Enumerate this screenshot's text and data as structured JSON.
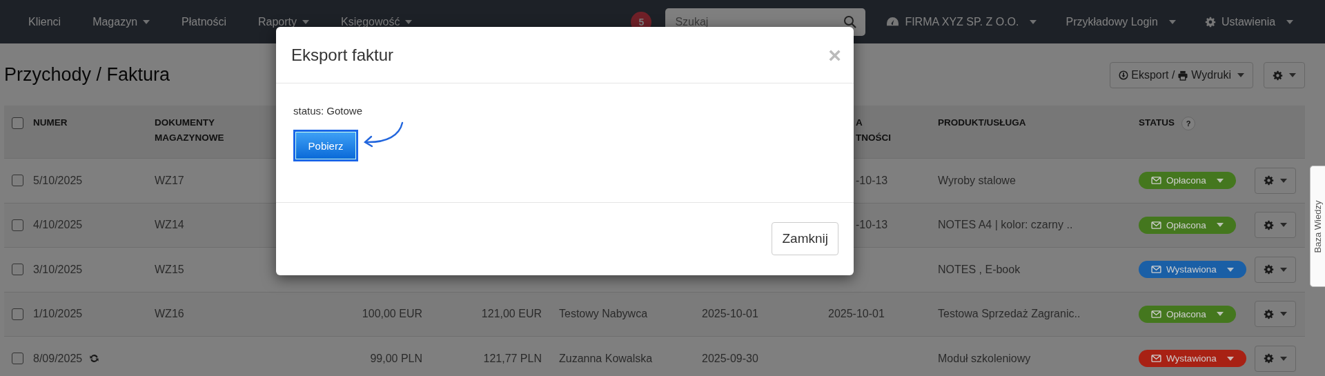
{
  "navbar": {
    "items": [
      {
        "label": "Klienci",
        "dropdown": false
      },
      {
        "label": "Magazyn",
        "dropdown": true
      },
      {
        "label": "Płatności",
        "dropdown": false
      },
      {
        "label": "Raporty",
        "dropdown": true
      },
      {
        "label": "Księgowość",
        "dropdown": true
      }
    ],
    "badge": "5",
    "search": {
      "placeholder": "Szukaj"
    },
    "right_items": [
      {
        "label": "FIRMA XYZ SP. Z O.O.",
        "dropdown": true
      },
      {
        "label": "Przykładowy Login",
        "dropdown": true
      },
      {
        "label": "Ustawienia",
        "dropdown": true
      }
    ]
  },
  "page": {
    "title": "Przychody / Faktura",
    "export_button": [
      "Eksport /",
      "Wydruki"
    ]
  },
  "table": {
    "header_checked": false,
    "columns": [
      {
        "lines": [
          "NUMER"
        ]
      },
      {
        "lines": [
          "DOKUMENTY",
          "MAGAZYNOWE"
        ]
      },
      {
        "lines": [
          "A",
          "TNOŚCI"
        ]
      },
      {
        "lines": [
          "PRODUKT/USŁUGA"
        ]
      },
      {
        "lines": [
          "STATUS"
        ],
        "help": "?"
      }
    ],
    "rows": [
      {
        "checked": false,
        "number": "5/10/2025",
        "recurring": false,
        "documents": "WZ17",
        "due_tail": "-10-13",
        "product": "Wyroby stalowe",
        "status": {
          "label": "Opłacona",
          "color": "#44771e"
        }
      },
      {
        "checked": false,
        "number": "4/10/2025",
        "recurring": false,
        "documents": "WZ14",
        "due_tail": "-10-13",
        "product": "NOTES A4 | kolor: czarny ..",
        "status": {
          "label": "Opłacona",
          "color": "#44771e"
        }
      },
      {
        "checked": false,
        "number": "3/10/2025",
        "recurring": false,
        "documents": "WZ15",
        "product": "NOTES , E-book",
        "status": {
          "label": "Wystawiona",
          "color": "#1a5fa6"
        }
      },
      {
        "checked": false,
        "number": "1/10/2025",
        "recurring": false,
        "documents": "WZ16",
        "net": "100,00 EUR",
        "gross": "121,00 EUR",
        "buyer": "Testowy Nabywca",
        "date": "2025-10-01",
        "due": "2025-10-01",
        "product": "Testowa Sprzedaż Zagranic..",
        "status": {
          "label": "Opłacona",
          "color": "#44771e"
        }
      },
      {
        "checked": false,
        "number": "8/09/2025",
        "recurring": true,
        "net": "99,00 PLN",
        "gross": "121,77 PLN",
        "buyer": "Zuzanna Kowalska",
        "date": "2025-09-30",
        "product": "Moduł szkoleniowy",
        "status": {
          "label": "Wystawiona",
          "color": "#a82114"
        }
      }
    ]
  },
  "side_tab": "Baza Wiedzy",
  "modal": {
    "title": "Eksport faktur",
    "close": "×",
    "status_text": "status: Gotowe",
    "download_button": "Pobierz",
    "close_button": "Zamknij"
  }
}
